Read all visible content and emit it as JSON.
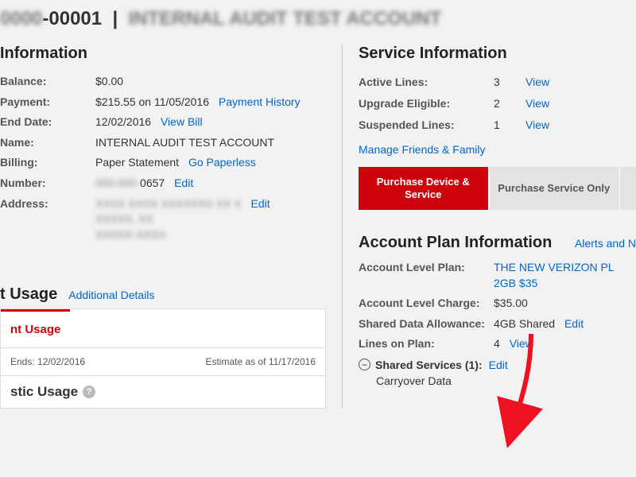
{
  "header": {
    "account_suffix": "-00001",
    "separator": "|",
    "account_name_obscured": "INTERNAL AUDIT TEST ACCOUNT"
  },
  "info": {
    "section_title": "Information",
    "rows": {
      "balance_label": "Balance:",
      "balance_value": "$0.00",
      "payment_label": "Payment:",
      "payment_value": "$215.55 on 11/05/2016",
      "payment_link": "Payment History",
      "enddate_label": "End Date:",
      "enddate_value": "12/02/2016",
      "enddate_link": "View Bill",
      "name_label": "Name:",
      "name_value": "INTERNAL AUDIT TEST ACCOUNT",
      "billing_label": "Billing:",
      "billing_value": "Paper Statement",
      "billing_link": "Go Paperless",
      "number_label": "Number:",
      "number_suffix": "0657",
      "number_link": "Edit",
      "address_label": "Address:",
      "address_link": "Edit"
    }
  },
  "usage": {
    "section_title": "t Usage",
    "details_link": "Additional Details",
    "tab_label": "nt Usage",
    "cycle_ends": "Ends: 12/02/2016",
    "estimate": "Estimate as of 11/17/2016",
    "domestic_label": "stic Usage"
  },
  "service": {
    "section_title": "Service Information",
    "active_label": "Active Lines:",
    "active_count": "3",
    "upgrade_label": "Upgrade Eligible:",
    "upgrade_count": "2",
    "suspended_label": "Suspended Lines:",
    "suspended_count": "1",
    "view": "View",
    "manage_link": "Manage Friends & Family",
    "btn_primary": "Purchase Device & Service",
    "btn_secondary": "Purchase Service Only"
  },
  "plan": {
    "section_title": "Account Plan Information",
    "alerts_link": "Alerts and N",
    "level_plan_label": "Account Level Plan:",
    "level_plan_value": "THE NEW VERIZON PL 2GB $35",
    "level_charge_label": "Account Level Charge:",
    "level_charge_value": "$35.00",
    "shared_allow_label": "Shared Data Allowance:",
    "shared_allow_value": "4GB Shared",
    "shared_allow_link": "Edit",
    "lines_label": "Lines on Plan:",
    "lines_value": "4",
    "lines_link": "View",
    "shared_services_label": "Shared Services (1):",
    "shared_services_link": "Edit",
    "carryover": "Carryover Data"
  }
}
